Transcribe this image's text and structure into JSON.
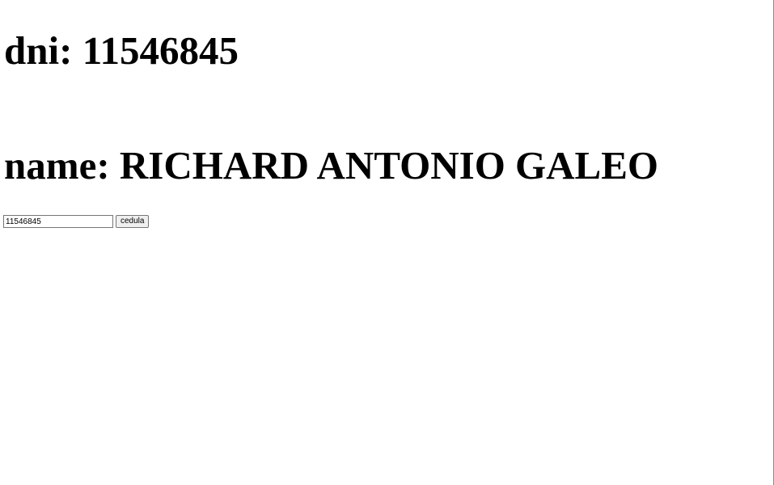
{
  "dni": {
    "label": "dni:",
    "value": "11546845"
  },
  "name": {
    "label": "name:",
    "value": "RICHARD ANTONIO GALEO"
  },
  "form": {
    "input_value": "11546845",
    "button_label": "cedula"
  }
}
